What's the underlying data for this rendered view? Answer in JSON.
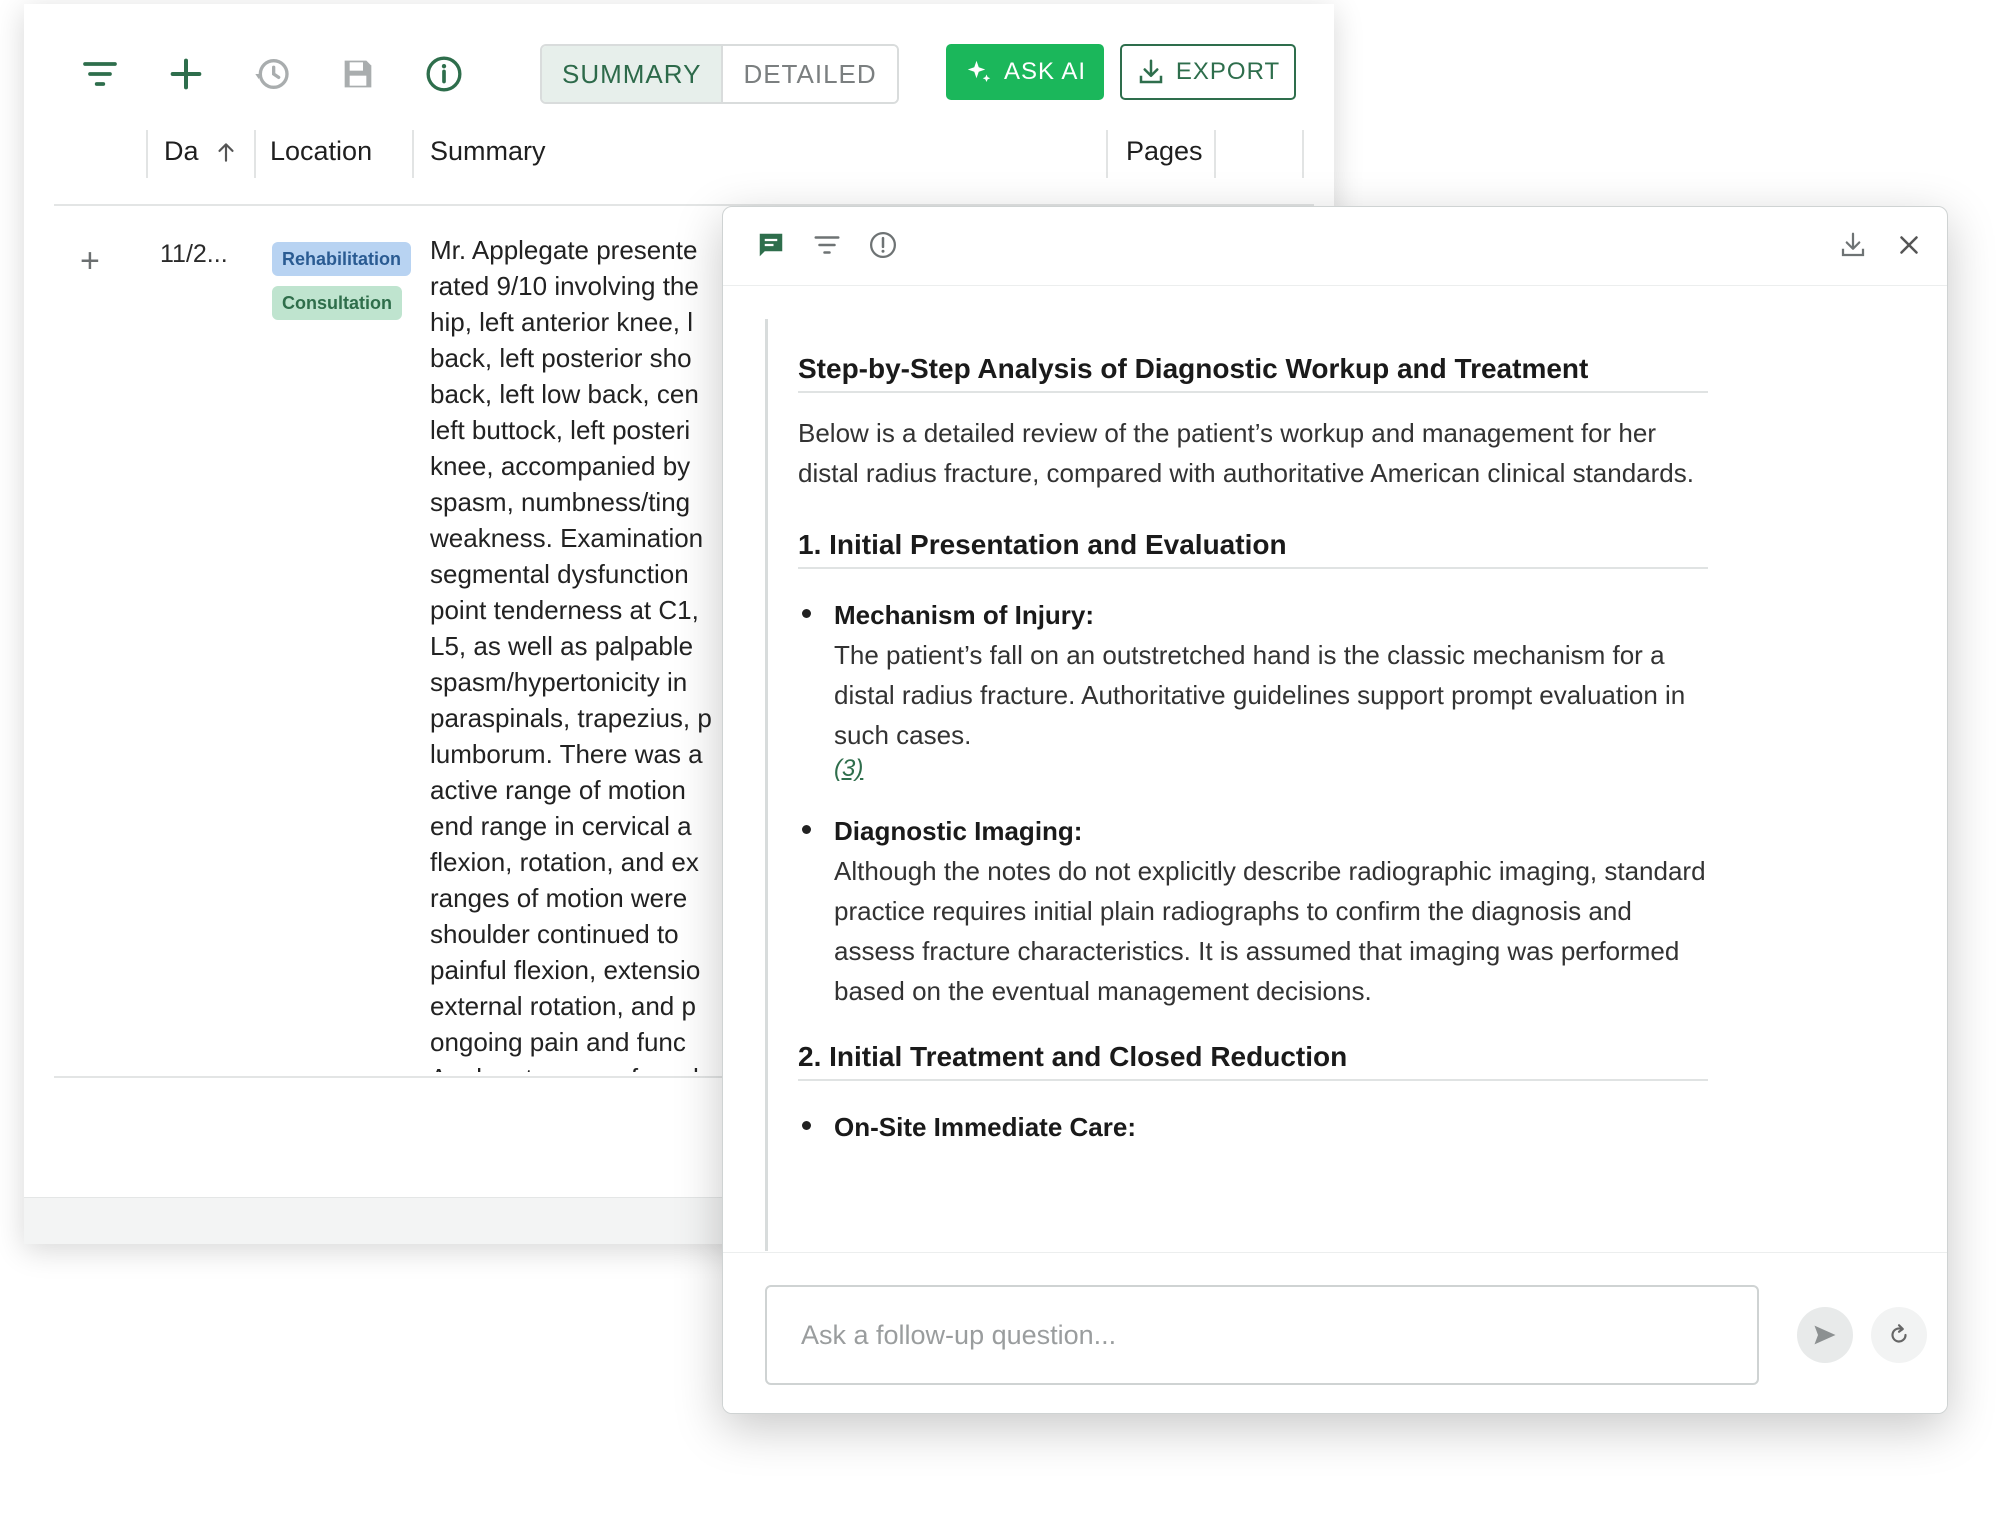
{
  "toolbar": {
    "icons": [
      "filter-icon",
      "plus-icon",
      "history-icon",
      "save-icon",
      "info-icon"
    ],
    "view_toggle": {
      "active": "SUMMARY",
      "inactive": "DETAILED"
    },
    "ask_ai_label": "ASK AI",
    "export_label": "EXPORT"
  },
  "table": {
    "columns": {
      "date": "Da",
      "location": "Location",
      "summary": "Summary",
      "pages": "Pages"
    },
    "row": {
      "date": "11/2...",
      "tags": [
        "Rehabilitation",
        "Consultation"
      ],
      "summary_lines": [
        "Mr. Applegate presente",
        "rated 9/10 involving the",
        "hip, left anterior knee, l",
        "back, left posterior sho",
        "back, left low back, cen",
        "left buttock, left posteri",
        "knee, accompanied by",
        "spasm, numbness/ting",
        "weakness. Examination",
        "segmental dysfunction",
        "point tenderness at C1,",
        "L5, as well as palpable",
        "spasm/hypertonicity in",
        "paraspinals, trapezius, p",
        "lumborum. There was a",
        "active range of motion",
        "end range in cervical a",
        "flexion, rotation, and ex",
        "ranges of motion were",
        "shoulder continued to",
        "painful flexion, extensio",
        "external rotation, and p",
        "ongoing pain and func",
        "Applegate was referred"
      ]
    }
  },
  "ai_panel": {
    "title": "Step-by-Step Analysis of Diagnostic Workup and Treatment",
    "intro": "Below is a detailed review of the patient’s workup and management for her distal radius fracture, compared with authoritative American clinical standards.",
    "section1_heading": "1. Initial Presentation and Evaluation",
    "bullet1_title": "Mechanism of Injury:",
    "bullet1_text": "The patient’s fall on an outstretched hand is the classic mechanism for a distal radius fracture. Authoritative guidelines support prompt evaluation in such cases.",
    "bullet1_cite": "(3)",
    "bullet2_title": "Diagnostic Imaging:",
    "bullet2_text": "Although the notes do not explicitly describe radiographic imaging, standard practice requires initial plain radiographs to confirm the diagnosis and assess fracture characteristics. It is assumed that imaging was performed based on the eventual management decisions.",
    "section2_heading": "2. Initial Treatment and Closed Reduction",
    "bullet3_title": "On-Site Immediate Care:",
    "input_placeholder": "Ask a follow-up question..."
  },
  "colors": {
    "accent": "#1bb75b",
    "brand_dark": "#2e6e4c"
  }
}
